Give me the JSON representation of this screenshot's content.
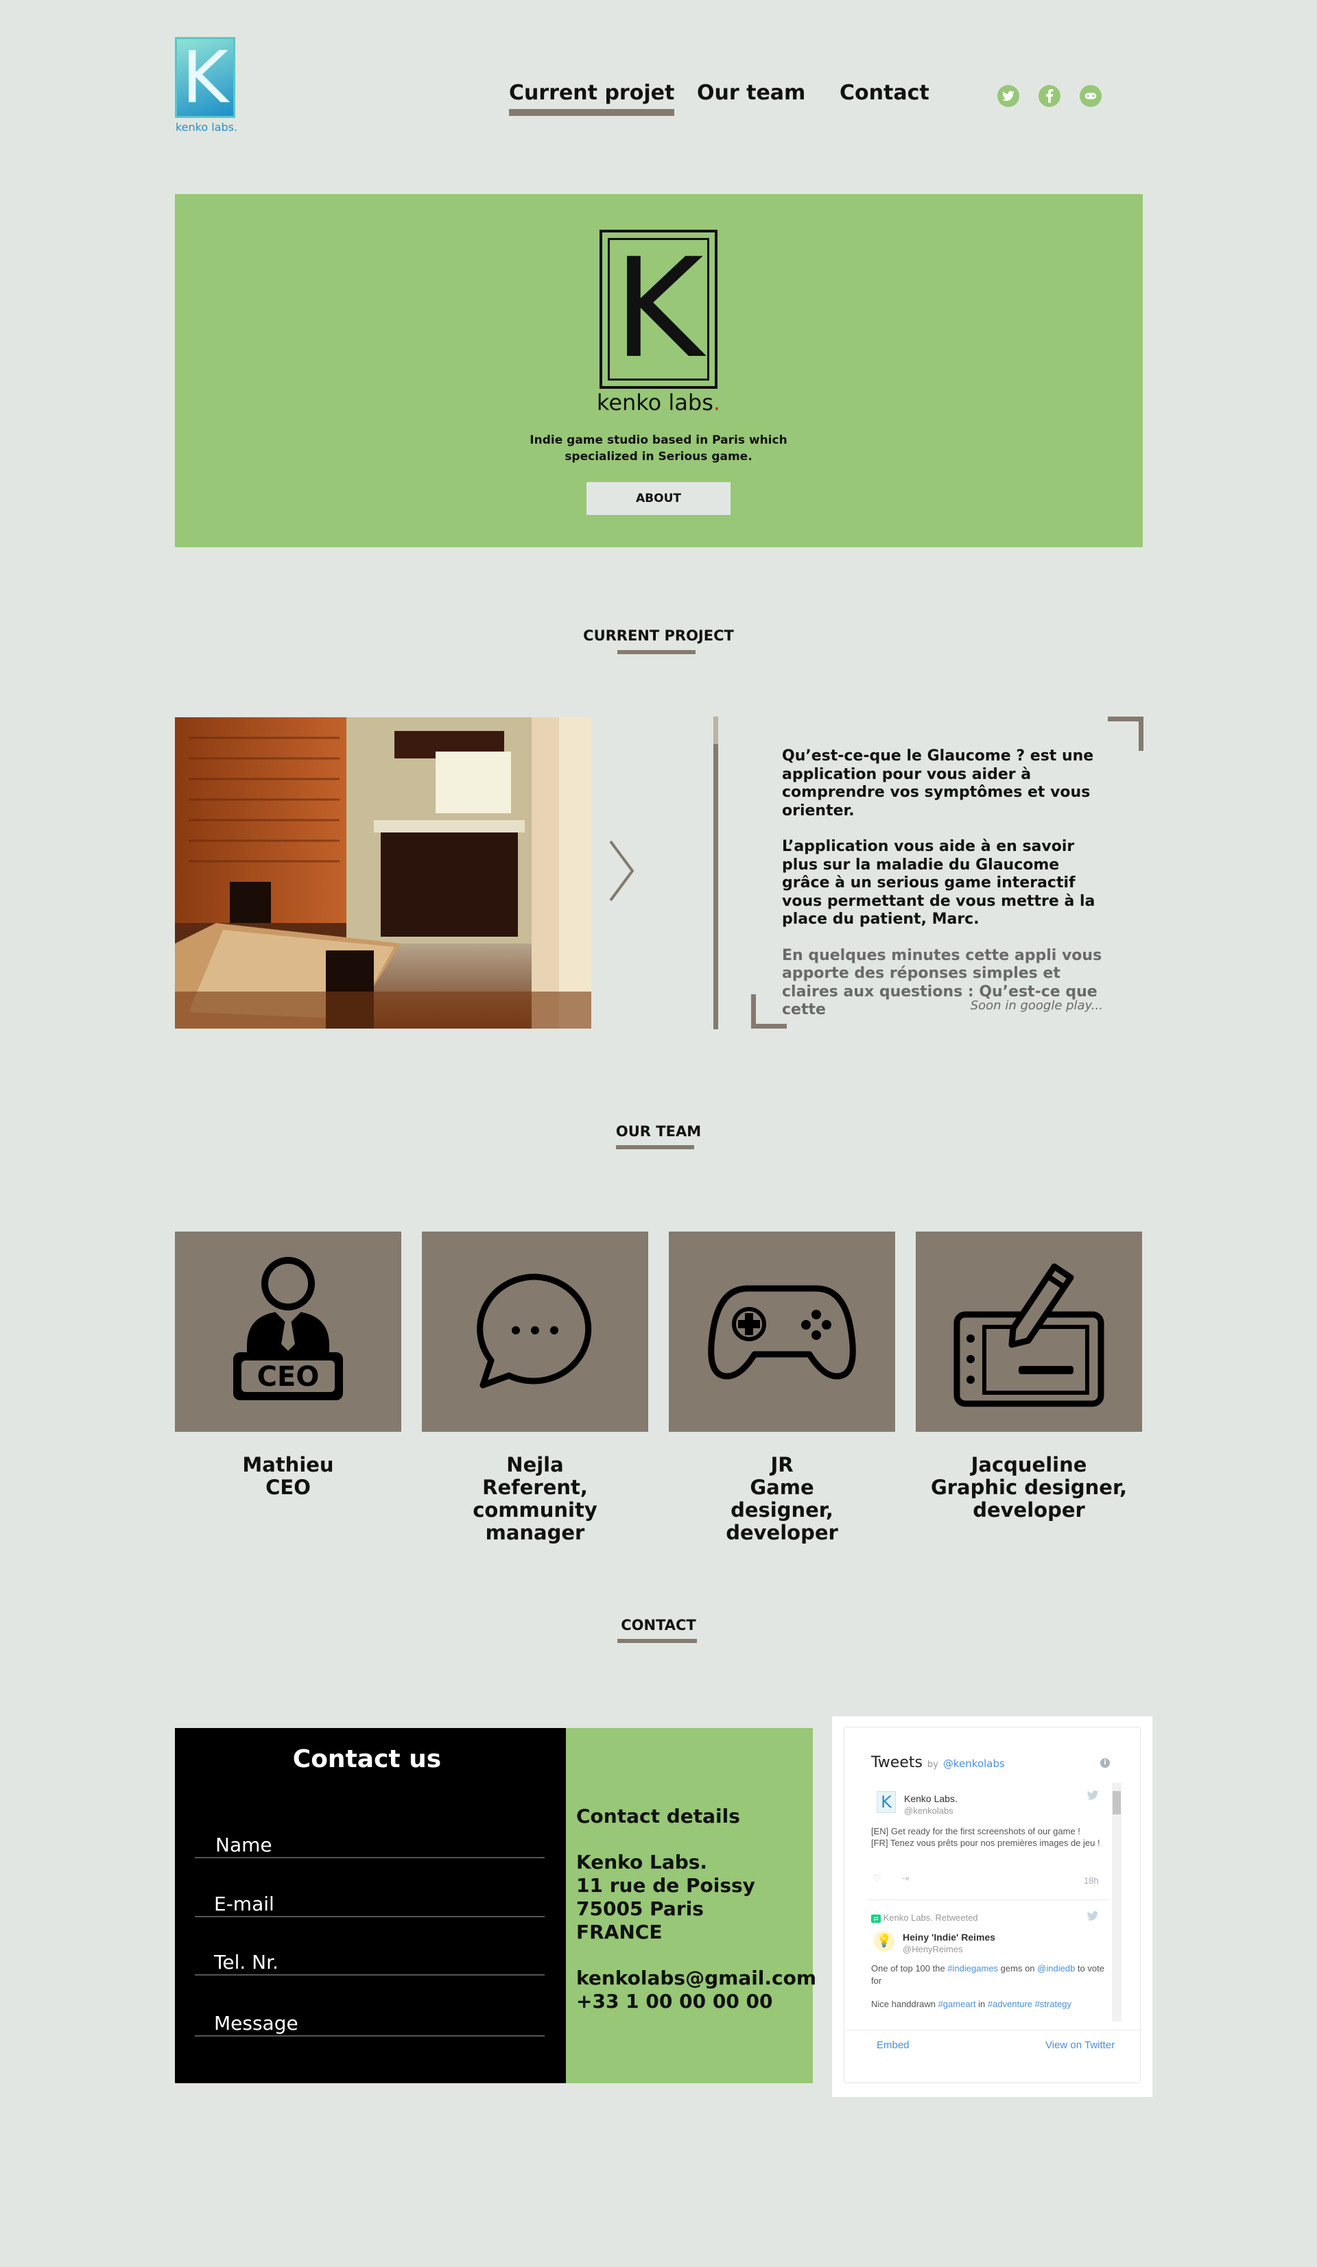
{
  "header": {
    "logo_text": "kenko labs.",
    "logo_letter": "K",
    "nav": [
      {
        "label": "Current projet",
        "active": true
      },
      {
        "label": "Our team",
        "active": false
      },
      {
        "label": "Contact",
        "active": false
      }
    ],
    "social": [
      {
        "icon": "twitter-icon",
        "glyph": "t"
      },
      {
        "icon": "facebook-icon",
        "glyph": "f"
      },
      {
        "icon": "gamepad-icon",
        "glyph": "◘"
      }
    ]
  },
  "hero": {
    "logo_letter": "K",
    "brand": "kenko labs",
    "brand_dot": ".",
    "description": "Indie game studio based in Paris which specialized in Serious game.",
    "button": "ABOUT"
  },
  "project": {
    "section_title": "CURRENT PROJECT",
    "paragraphs": [
      "Qu’est-ce-que le Glaucome ? est une application pour vous aider à comprendre vos symptômes et vous orienter.",
      "L’application vous aide à en savoir plus sur la maladie du Glaucome grâce à un serious game interactif vous permettant de vous mettre à la place du patient, Marc."
    ],
    "faded_paragraph": "En quelques minutes cette appli vous apporte des réponses simples et claires aux questions : Qu’est-ce que cette",
    "soon": "Soon in google play..."
  },
  "team": {
    "section_title": "OUR TEAM",
    "members": [
      {
        "name": "Mathieu",
        "role": "CEO",
        "icon": "ceo-person-icon",
        "badge": "CEO"
      },
      {
        "name": "Nejla",
        "role": "Referent, community manager",
        "icon": "speech-bubble-icon"
      },
      {
        "name": "JR",
        "role": "Game designer, developer",
        "icon": "gamepad-icon"
      },
      {
        "name": "Jacqueline",
        "role": "Graphic designer, developer",
        "icon": "graphic-tablet-icon"
      }
    ]
  },
  "contact": {
    "section_title": "CONTACT",
    "form_title": "Contact us",
    "fields": [
      "Name",
      "E-mail",
      "Tel. Nr.",
      "Message"
    ],
    "details_title": "Contact details",
    "address": [
      "Kenko Labs.",
      "11 rue de Poissy",
      "75005 Paris",
      "FRANCE"
    ],
    "email": "kenkolabs@gmail.com",
    "phone": "+33 1 00 00 00 00"
  },
  "twitter": {
    "title": "Tweets",
    "by": "by",
    "handle": "@kenkolabs",
    "tweet1": {
      "name": "Kenko Labs.",
      "handle": "@kenkolabs",
      "text_en": "[EN] Get ready for the first screenshots of our game !",
      "text_fr": "[FR] Tenez vous prêts pour nos premières images de jeu !",
      "time": "18h"
    },
    "retweet_label": "Kenko Labs. Retweeted",
    "tweet2": {
      "name": "Heiny 'Indie' Reimes",
      "handle": "@HenyReimes",
      "text_a": "One of top 100 the",
      "tag_a": "#indiegames",
      "text_b": "gems on",
      "tag_b": "@indiedb",
      "text_c": "to vote for",
      "text_d": "Nice handdrawn",
      "tag_c": "#gameart",
      "text_e": "in",
      "tag_d": "#adventure",
      "tag_e": "#strategy"
    },
    "embed": "Embed",
    "view": "View on Twitter"
  },
  "colors": {
    "background": "#e1e6e2",
    "green": "#97c777",
    "taupe": "#847a6e",
    "black": "#000000",
    "twitter_blue": "#4a90d9"
  }
}
